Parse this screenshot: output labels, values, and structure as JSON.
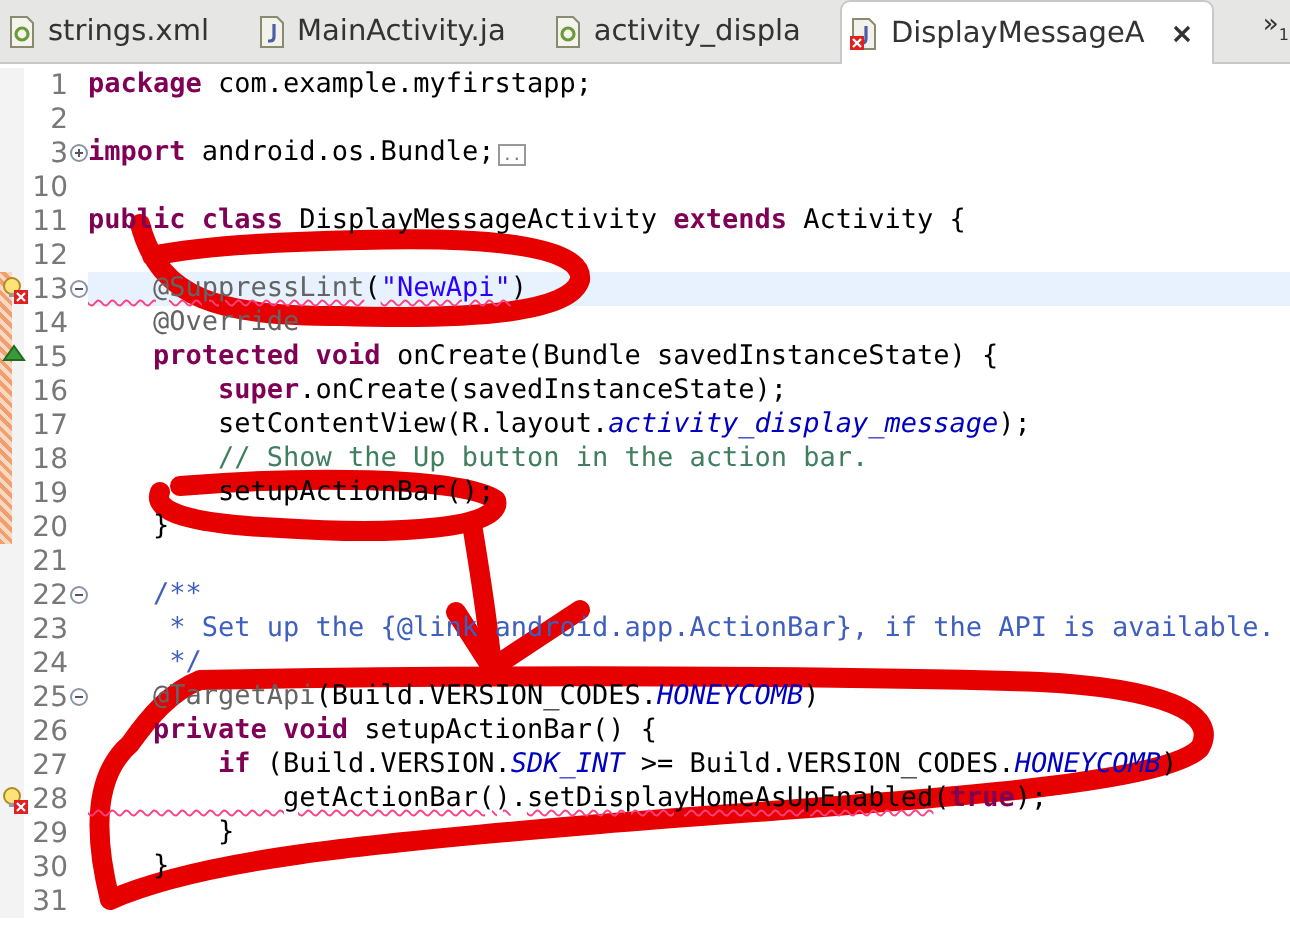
{
  "tabs": [
    {
      "label": "strings.xml",
      "kind": "xml",
      "error": false,
      "selected": false
    },
    {
      "label": "MainActivity.ja",
      "kind": "java",
      "error": false,
      "selected": false
    },
    {
      "label": "activity_displa",
      "kind": "xml",
      "error": false,
      "selected": false
    },
    {
      "label": "DisplayMessageA",
      "kind": "java",
      "error": true,
      "selected": true
    }
  ],
  "overflow": {
    "symbol": "»",
    "count": "1"
  },
  "lines": [
    {
      "number": "1",
      "error": false,
      "overrides": false,
      "changed": false,
      "current": false,
      "tokens": [
        {
          "text": "package ",
          "kind": "keyword",
          "squiggle": false
        },
        {
          "text": "com.example.myfirstapp;",
          "kind": "plain",
          "squiggle": false
        }
      ]
    },
    {
      "number": "2",
      "error": false,
      "overrides": false,
      "changed": false,
      "current": false
    },
    {
      "number": "3",
      "folded": true,
      "error": false,
      "overrides": false,
      "changed": false,
      "current": false,
      "tokens": [
        {
          "text": "import ",
          "kind": "keyword",
          "squiggle": false
        },
        {
          "text": "android.os.Bundle;",
          "kind": "plain",
          "squiggle": false
        },
        {
          "text": "..",
          "kind": "folded",
          "squiggle": false
        }
      ]
    },
    {
      "number": "10",
      "error": false,
      "overrides": false,
      "changed": false,
      "current": false
    },
    {
      "number": "11",
      "error": false,
      "overrides": false,
      "changed": false,
      "current": false,
      "tokens": [
        {
          "text": "public class ",
          "kind": "keyword",
          "squiggle": false
        },
        {
          "text": "DisplayMessageActivity ",
          "kind": "plain",
          "squiggle": false
        },
        {
          "text": "extends ",
          "kind": "keyword",
          "squiggle": false
        },
        {
          "text": "Activity {",
          "kind": "plain",
          "squiggle": false
        }
      ]
    },
    {
      "number": "12",
      "error": false,
      "overrides": false,
      "changed": false,
      "current": false
    },
    {
      "number": "13",
      "folded": false,
      "error": true,
      "overrides": false,
      "changed": true,
      "current": true,
      "tokens": [
        {
          "text": "    @SuppressLint",
          "kind": "annotation",
          "squiggle": true
        },
        {
          "text": "(",
          "kind": "plain",
          "squiggle": false
        },
        {
          "text": "\"NewApi\"",
          "kind": "string",
          "squiggle": true
        },
        {
          "text": ")",
          "kind": "plain",
          "squiggle": false
        }
      ]
    },
    {
      "number": "14",
      "error": false,
      "overrides": false,
      "changed": true,
      "current": false,
      "tokens": [
        {
          "text": "    @Override",
          "kind": "annotation",
          "squiggle": false
        }
      ]
    },
    {
      "number": "15",
      "error": false,
      "overrides": true,
      "changed": true,
      "current": false,
      "tokens": [
        {
          "text": "    protected void ",
          "kind": "keyword",
          "squiggle": false
        },
        {
          "text": "onCreate(Bundle savedInstanceState) {",
          "kind": "plain",
          "squiggle": false
        }
      ]
    },
    {
      "number": "16",
      "error": false,
      "overrides": false,
      "changed": true,
      "current": false,
      "tokens": [
        {
          "text": "        super",
          "kind": "keyword",
          "squiggle": false
        },
        {
          "text": ".onCreate(savedInstanceState);",
          "kind": "plain",
          "squiggle": false
        }
      ]
    },
    {
      "number": "17",
      "error": false,
      "overrides": false,
      "changed": true,
      "current": false,
      "tokens": [
        {
          "text": "        setContentView(R.layout.",
          "kind": "plain",
          "squiggle": false
        },
        {
          "text": "activity_display_message",
          "kind": "field",
          "squiggle": false
        },
        {
          "text": ");",
          "kind": "plain",
          "squiggle": false
        }
      ]
    },
    {
      "number": "18",
      "error": false,
      "overrides": false,
      "changed": true,
      "current": false,
      "tokens": [
        {
          "text": "        // Show the Up button in the action bar.",
          "kind": "comment",
          "squiggle": false
        }
      ]
    },
    {
      "number": "19",
      "error": false,
      "overrides": false,
      "changed": true,
      "current": false,
      "tokens": [
        {
          "text": "        setupActionBar();",
          "kind": "plain",
          "squiggle": false
        }
      ]
    },
    {
      "number": "20",
      "error": false,
      "overrides": false,
      "changed": true,
      "current": false,
      "tokens": [
        {
          "text": "    }",
          "kind": "plain",
          "squiggle": false
        }
      ]
    },
    {
      "number": "21",
      "error": false,
      "overrides": false,
      "changed": false,
      "current": false
    },
    {
      "number": "22",
      "folded": false,
      "error": false,
      "overrides": false,
      "changed": false,
      "current": false,
      "tokens": [
        {
          "text": "    /**",
          "kind": "javadoc",
          "squiggle": false
        }
      ]
    },
    {
      "number": "23",
      "error": false,
      "overrides": false,
      "changed": false,
      "current": false,
      "tokens": [
        {
          "text": "     * Set up the {@link android.app.ActionBar}, if the API is available.",
          "kind": "javadoc",
          "squiggle": false
        }
      ]
    },
    {
      "number": "24",
      "error": false,
      "overrides": false,
      "changed": false,
      "current": false,
      "tokens": [
        {
          "text": "     */",
          "kind": "javadoc",
          "squiggle": false
        }
      ]
    },
    {
      "number": "25",
      "folded": false,
      "error": false,
      "overrides": false,
      "changed": false,
      "current": false,
      "tokens": [
        {
          "text": "    @TargetApi",
          "kind": "annotation",
          "squiggle": false
        },
        {
          "text": "(Build.VERSION_CODES.",
          "kind": "plain",
          "squiggle": false
        },
        {
          "text": "HONEYCOMB",
          "kind": "field",
          "squiggle": false
        },
        {
          "text": ")",
          "kind": "plain",
          "squiggle": false
        }
      ]
    },
    {
      "number": "26",
      "error": false,
      "overrides": false,
      "changed": false,
      "current": false,
      "tokens": [
        {
          "text": "    private void ",
          "kind": "keyword",
          "squiggle": false
        },
        {
          "text": "setupActionBar() {",
          "kind": "plain",
          "squiggle": false
        }
      ]
    },
    {
      "number": "27",
      "error": false,
      "overrides": false,
      "changed": false,
      "current": false,
      "tokens": [
        {
          "text": "        if ",
          "kind": "keyword",
          "squiggle": false
        },
        {
          "text": "(Build.VERSION.",
          "kind": "plain",
          "squiggle": false
        },
        {
          "text": "SDK_INT",
          "kind": "field",
          "squiggle": false
        },
        {
          "text": " >= Build.VERSION_CODES.",
          "kind": "plain",
          "squiggle": false
        },
        {
          "text": "HONEYCOMB",
          "kind": "field",
          "squiggle": false
        },
        {
          "text": ")",
          "kind": "plain",
          "squiggle": false
        }
      ]
    },
    {
      "number": "28",
      "error": true,
      "overrides": false,
      "changed": false,
      "current": false,
      "tokens": [
        {
          "text": "            getActionBar()",
          "kind": "plain",
          "squiggle": true
        },
        {
          "text": ".",
          "kind": "plain",
          "squiggle": false
        },
        {
          "text": "setDisplayHomeAsUpEnabled",
          "kind": "plain",
          "squiggle": true
        },
        {
          "text": "(",
          "kind": "plain",
          "squiggle": false
        },
        {
          "text": "true",
          "kind": "keyword",
          "squiggle": false
        },
        {
          "text": ");",
          "kind": "plain",
          "squiggle": false
        }
      ]
    },
    {
      "number": "29",
      "error": false,
      "overrides": false,
      "changed": false,
      "current": false,
      "tokens": [
        {
          "text": "        }",
          "kind": "plain",
          "squiggle": false
        }
      ]
    },
    {
      "number": "30",
      "error": false,
      "overrides": false,
      "changed": false,
      "current": false,
      "tokens": [
        {
          "text": "    }",
          "kind": "plain",
          "squiggle": false
        }
      ]
    },
    {
      "number": "31",
      "error": false,
      "overrides": false,
      "changed": false,
      "current": false
    }
  ]
}
